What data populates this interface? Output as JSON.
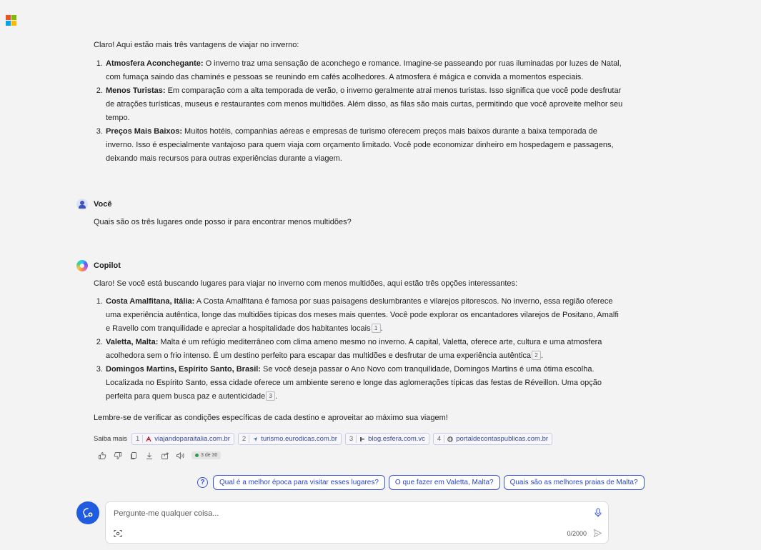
{
  "first_response": {
    "intro": "Claro! Aqui estão mais três vantagens de viajar no inverno:",
    "items": [
      {
        "title": "Atmosfera Aconchegante:",
        "text": " O inverno traz uma sensação de aconchego e romance. Imagine-se passeando por ruas iluminadas por luzes de Natal, com fumaça saindo das chaminés e pessoas se reunindo em cafés acolhedores. A atmosfera é mágica e convida a momentos especiais."
      },
      {
        "title": "Menos Turistas:",
        "text": " Em comparação com a alta temporada de verão, o inverno geralmente atrai menos turistas. Isso significa que você pode desfrutar de atrações turísticas, museus e restaurantes com menos multidões. Além disso, as filas são mais curtas, permitindo que você aproveite melhor seu tempo."
      },
      {
        "title": "Preços Mais Baixos:",
        "text": " Muitos hotéis, companhias aéreas e empresas de turismo oferecem preços mais baixos durante a baixa temporada de inverno. Isso é especialmente vantajoso para quem viaja com orçamento limitado. Você pode economizar dinheiro em hospedagem e passagens, deixando mais recursos para outras experiências durante a viagem."
      }
    ]
  },
  "user_message": {
    "speaker": "Você",
    "text": "Quais são os três lugares onde posso ir para encontrar menos multidões?"
  },
  "copilot_response": {
    "speaker": "Copilot",
    "intro": "Claro! Se você está buscando lugares para viajar no inverno com menos multidões, aqui estão três opções interessantes:",
    "items": [
      {
        "title": "Costa Amalfitana, Itália:",
        "text": " A Costa Amalfitana é famosa por suas paisagens deslumbrantes e vilarejos pitorescos. No inverno, essa região oferece uma experiência autêntica, longe das multidões típicas dos meses mais quentes. Você pode explorar os encantadores vilarejos de Positano, Amalfi e Ravello com tranquilidade e apreciar a hospitalidade dos habitantes locais",
        "cite": "1",
        "end": "."
      },
      {
        "title": "Valetta, Malta:",
        "text": " Malta é um refúgio mediterrâneo com clima ameno mesmo no inverno. A capital, Valetta, oferece arte, cultura e uma atmosfera acolhedora sem o frio intenso. É um destino perfeito para escapar das multidões e desfrutar de uma experiência autêntica",
        "cite": "2",
        "end": "."
      },
      {
        "title": "Domingos Martins, Espírito Santo, Brasil:",
        "text": " Se você deseja passar o Ano Novo com tranquilidade, Domingos Martins é uma ótima escolha. Localizada no Espírito Santo, essa cidade oferece um ambiente sereno e longe das aglomerações típicas das festas de Réveillon. Uma opção perfeita para quem busca paz e autenticidade",
        "cite": "3",
        "end": "."
      }
    ],
    "closing": "Lembre-se de verificar as condições específicas de cada destino e aproveitar ao máximo sua viagem!",
    "learn_more_label": "Saiba mais",
    "sources": [
      {
        "num": "1",
        "domain": "viajandoparaitalia.com.br",
        "icon": "pdf-icon",
        "color": "#c8102e"
      },
      {
        "num": "2",
        "domain": "turismo.eurodicas.com.br",
        "icon": "plane-icon",
        "color": "#4a6fa5"
      },
      {
        "num": "3",
        "domain": "blog.esfera.com.vc",
        "icon": "esfera-icon",
        "color": "#555555"
      },
      {
        "num": "4",
        "domain": "portaldecontaspublicas.com.br",
        "icon": "globe-icon",
        "color": "#555555"
      }
    ],
    "response_counter": "3 de 30"
  },
  "suggestions": [
    "Qual é a melhor época para visitar esses lugares?",
    "O que fazer em Valetta, Malta?",
    "Quais são as melhores praias de Malta?"
  ],
  "composer": {
    "placeholder": "Pergunte-me qualquer coisa...",
    "char_count": "0/2000"
  },
  "colors": {
    "accent": "#2b45c8",
    "new_topic_button": "#1f5ce0",
    "background": "#f3f3f3"
  }
}
